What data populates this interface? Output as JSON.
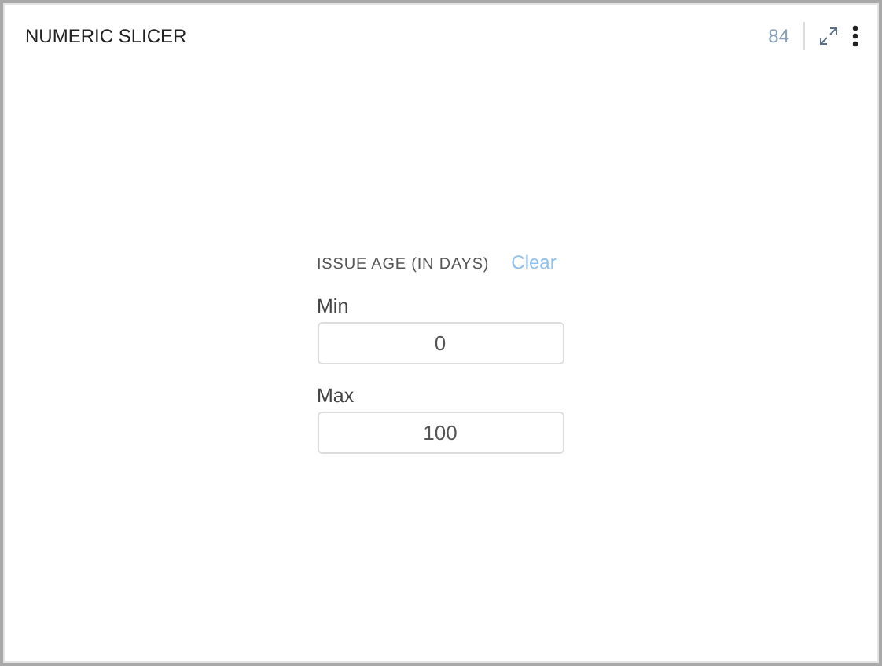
{
  "widget": {
    "title": "NUMERIC SLICER",
    "count": "84"
  },
  "filter": {
    "label": "ISSUE AGE (IN DAYS)",
    "clear": "Clear",
    "fields": [
      {
        "label": "Min",
        "value": "0"
      },
      {
        "label": "Max",
        "value": "100"
      }
    ]
  }
}
